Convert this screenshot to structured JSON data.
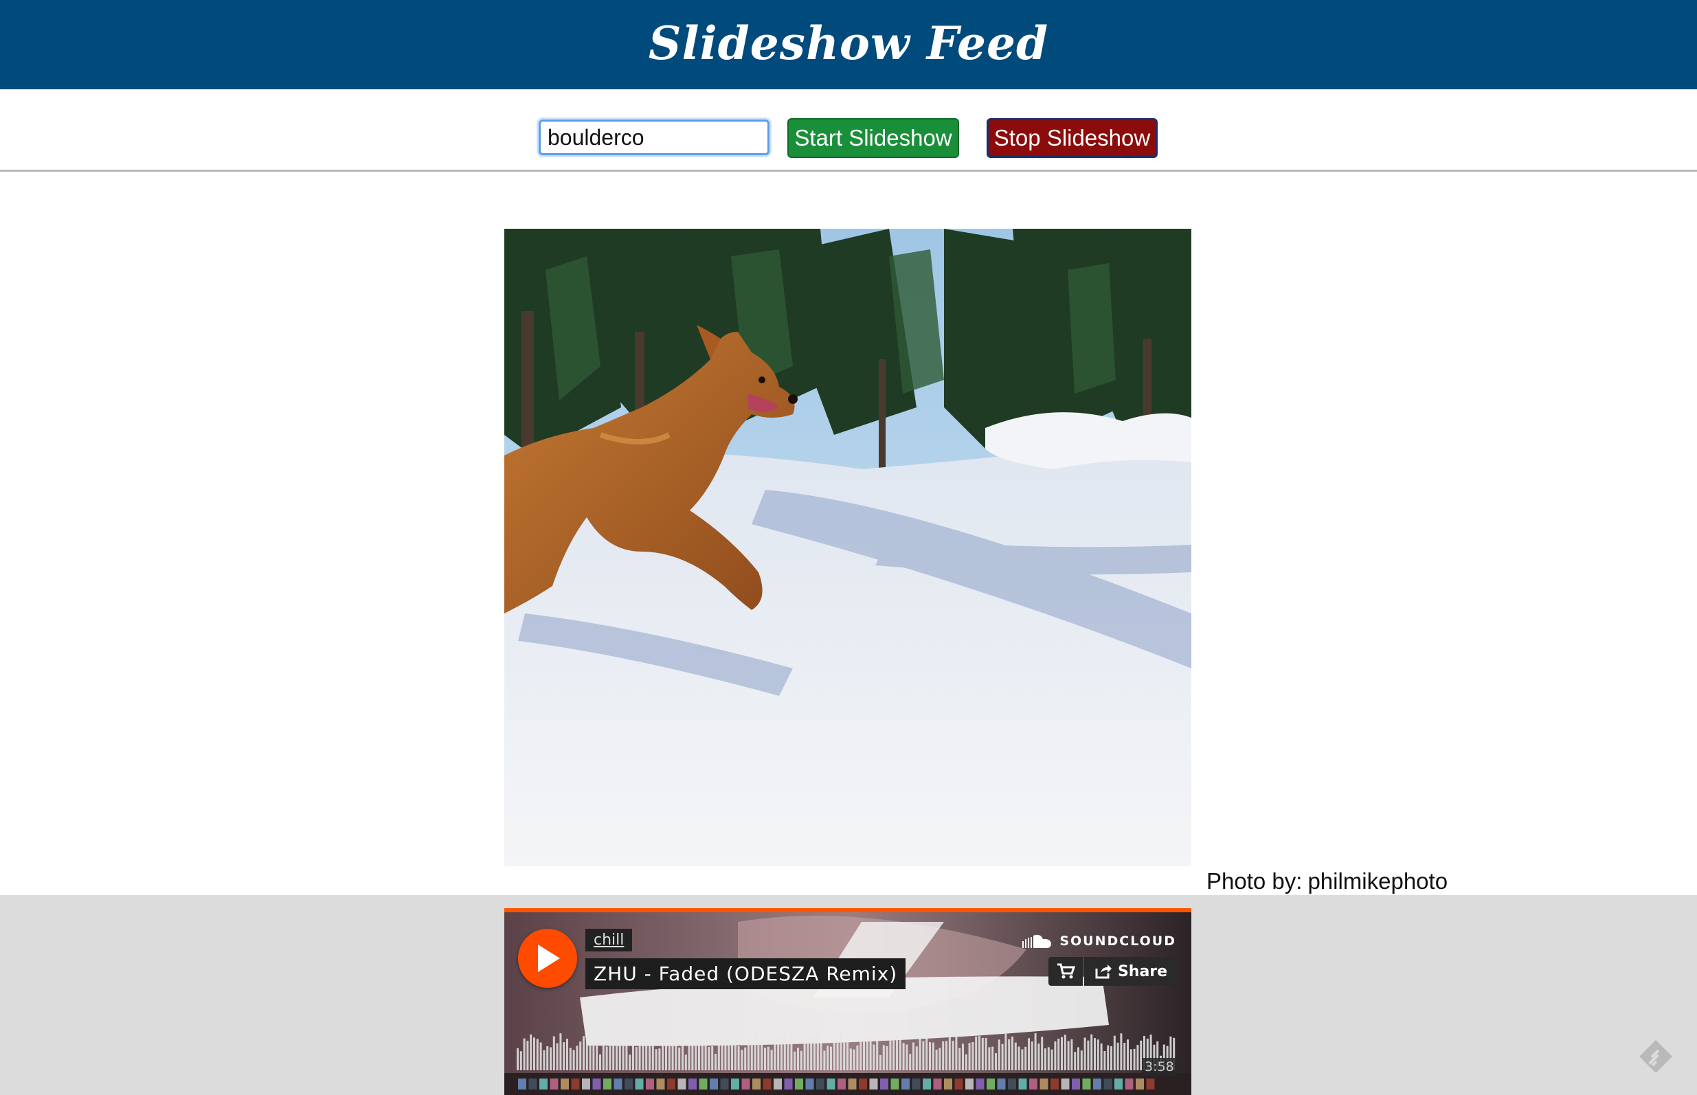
{
  "header": {
    "title": "Slideshow Feed"
  },
  "controls": {
    "search_value": "boulderco",
    "start_label": "Start Slideshow",
    "stop_label": "Stop Slideshow"
  },
  "photo": {
    "credit_prefix": "Photo by:",
    "credit_user": "philmikephoto"
  },
  "player": {
    "user": "chill",
    "track_title": "ZHU - Faded (ODESZA Remix)",
    "brand": "SOUNDCLOUD",
    "share_label": "Share",
    "duration": "3:58",
    "icons": [
      "play-icon",
      "soundcloud-logo-icon",
      "cart-icon",
      "share-icon"
    ]
  },
  "colors": {
    "header_bg": "#004a7c",
    "start_btn": "#1a8f3a",
    "stop_btn": "#8c0b0b",
    "soundcloud_orange": "#ff5500"
  },
  "corner_icon": "feedly-icon"
}
